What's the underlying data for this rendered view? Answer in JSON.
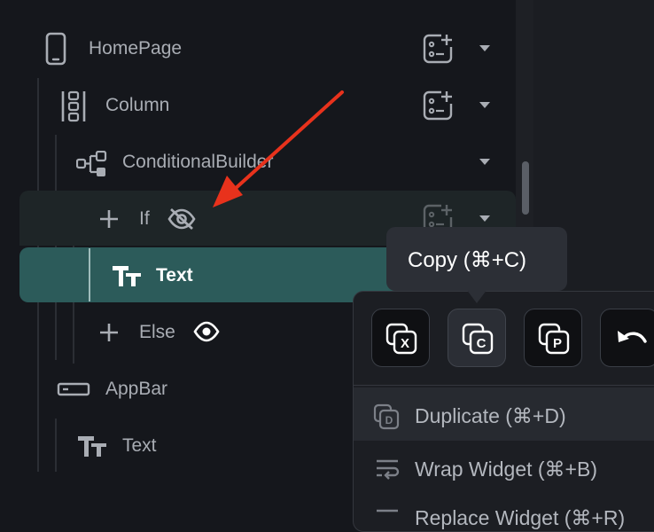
{
  "tree": {
    "homepage": {
      "label": "HomePage"
    },
    "column": {
      "label": "Column"
    },
    "conditional": {
      "label": "ConditionalBuilder"
    },
    "if_branch": {
      "label": "If"
    },
    "text_selected": {
      "label": "Text"
    },
    "else_branch": {
      "label": "Else"
    },
    "appbar": {
      "label": "AppBar"
    },
    "text2": {
      "label": "Text"
    }
  },
  "tooltip": {
    "text": "Copy (⌘+C)"
  },
  "context_menu": {
    "toolbar": [
      {
        "name": "cut-icon",
        "letter": "X"
      },
      {
        "name": "copy-icon",
        "letter": "C"
      },
      {
        "name": "paste-icon",
        "letter": "P"
      },
      {
        "name": "undo-icon"
      }
    ],
    "items": [
      {
        "icon": "duplicate-icon",
        "label": "Duplicate (⌘+D)"
      },
      {
        "icon": "wrap-icon",
        "label": "Wrap Widget (⌘+B)"
      },
      {
        "icon": "replace-icon",
        "label": "Replace Widget (⌘+R)"
      }
    ]
  },
  "colors": {
    "background": "#15171c",
    "selected_row": "#2c5b5a",
    "annotation_arrow": "#e8321c"
  }
}
